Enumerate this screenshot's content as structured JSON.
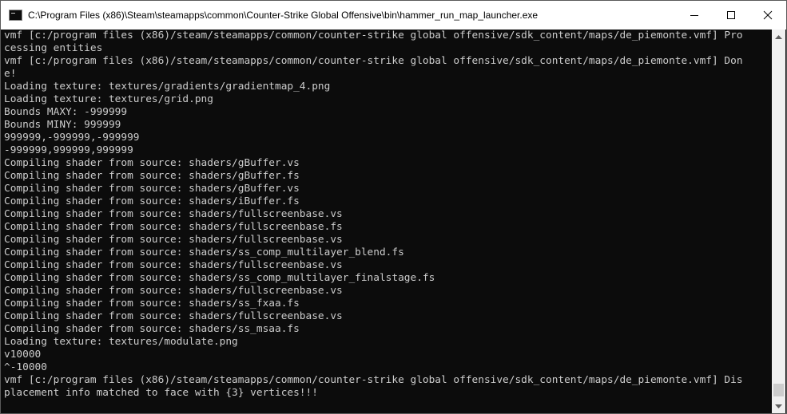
{
  "window": {
    "title": "C:\\Program Files (x86)\\Steam\\steamapps\\common\\Counter-Strike Global Offensive\\bin\\hammer_run_map_launcher.exe",
    "minimize_icon": "minimize-icon",
    "maximize_icon": "maximize-icon",
    "close_icon": "close-icon"
  },
  "colors": {
    "console_background": "#0c0c0c",
    "console_text": "#cccccc",
    "titlebar_background": "#ffffff"
  },
  "console": {
    "lines": [
      "vmf [c:/program files (x86)/steam/steamapps/common/counter-strike global offensive/sdk_content/maps/de_piemonte.vmf] Pro",
      "cessing entities",
      "vmf [c:/program files (x86)/steam/steamapps/common/counter-strike global offensive/sdk_content/maps/de_piemonte.vmf] Don",
      "e!",
      "Loading texture: textures/gradients/gradientmap_4.png",
      "Loading texture: textures/grid.png",
      "Bounds MAXY: -999999",
      "Bounds MINY: 999999",
      "999999,-999999,-999999",
      "-999999,999999,999999",
      "Compiling shader from source: shaders/gBuffer.vs",
      "Compiling shader from source: shaders/gBuffer.fs",
      "Compiling shader from source: shaders/gBuffer.vs",
      "Compiling shader from source: shaders/iBuffer.fs",
      "Compiling shader from source: shaders/fullscreenbase.vs",
      "Compiling shader from source: shaders/fullscreenbase.fs",
      "Compiling shader from source: shaders/fullscreenbase.vs",
      "Compiling shader from source: shaders/ss_comp_multilayer_blend.fs",
      "Compiling shader from source: shaders/fullscreenbase.vs",
      "Compiling shader from source: shaders/ss_comp_multilayer_finalstage.fs",
      "Compiling shader from source: shaders/fullscreenbase.vs",
      "Compiling shader from source: shaders/ss_fxaa.fs",
      "Compiling shader from source: shaders/fullscreenbase.vs",
      "Compiling shader from source: shaders/ss_msaa.fs",
      "Loading texture: textures/modulate.png",
      "v10000",
      "^-10000",
      "vmf [c:/program files (x86)/steam/steamapps/common/counter-strike global offensive/sdk_content/maps/de_piemonte.vmf] Dis",
      "placement info matched to face with {3} vertices!!!"
    ]
  }
}
